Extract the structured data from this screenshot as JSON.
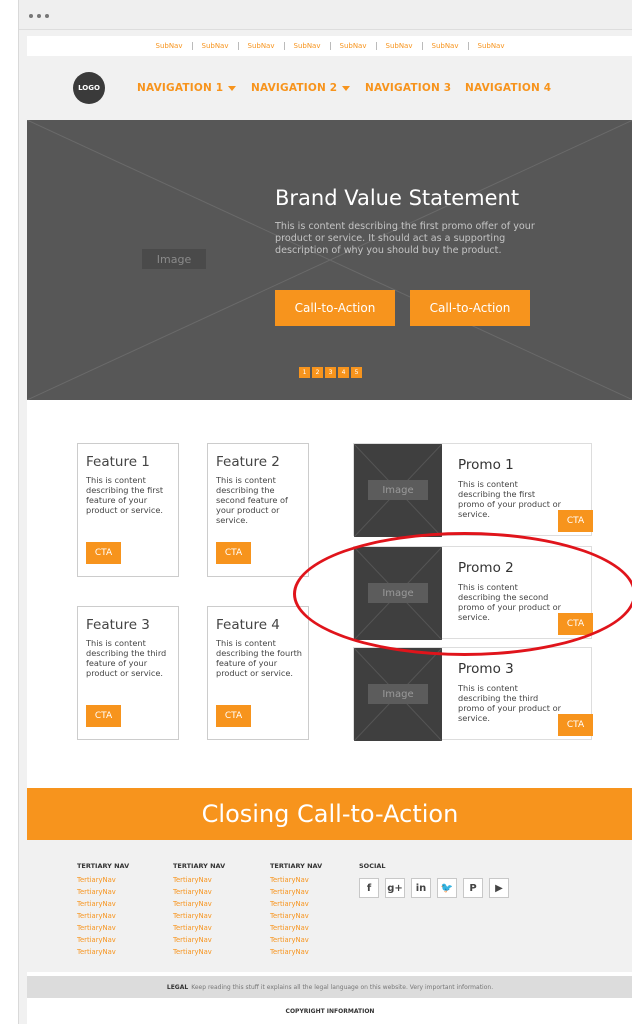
{
  "subnav": [
    "SubNav",
    "SubNav",
    "SubNav",
    "SubNav",
    "SubNav",
    "SubNav",
    "SubNav",
    "SubNav"
  ],
  "header": {
    "logo": "LOGO",
    "nav": [
      "NAVIGATION 1",
      "NAVIGATION 2",
      "NAVIGATION 3",
      "NAVIGATION 4"
    ]
  },
  "hero": {
    "image_label": "Image",
    "title": "Brand Value Statement",
    "description": "This is content describing the first promo offer of your product or service. It should act as a supporting description of why you should buy the product.",
    "cta1": "Call-to-Action",
    "cta2": "Call-to-Action",
    "pages": [
      "1",
      "2",
      "3",
      "4",
      "5"
    ]
  },
  "features": [
    {
      "title": "Feature 1",
      "desc": "This is content describing the first feature of your product or service.",
      "cta": "CTA"
    },
    {
      "title": "Feature 2",
      "desc": "This is content describing the second feature of your product or service.",
      "cta": "CTA"
    },
    {
      "title": "Feature 3",
      "desc": "This is content describing the third feature of your product or service.",
      "cta": "CTA"
    },
    {
      "title": "Feature 4",
      "desc": "This is content describing the fourth feature of your product or service.",
      "cta": "CTA"
    }
  ],
  "promos": [
    {
      "title": "Promo 1",
      "desc": "This is content describing the first promo of your product or service.",
      "cta": "CTA",
      "image_label": "Image"
    },
    {
      "title": "Promo 2",
      "desc": "This is content describing the second promo of your product or service.",
      "cta": "CTA",
      "image_label": "Image"
    },
    {
      "title": "Promo 3",
      "desc": "This is content describing the third promo of your product or service.",
      "cta": "CTA",
      "image_label": "Image"
    }
  ],
  "closing": "Closing Call-to-Action",
  "footer": {
    "columns": [
      {
        "heading": "TERTIARY NAV",
        "links": [
          "TertiaryNav",
          "TertiaryNav",
          "TertiaryNav",
          "TertiaryNav",
          "TertiaryNav",
          "TertiaryNav",
          "TertiaryNav"
        ]
      },
      {
        "heading": "TERTIARY NAV",
        "links": [
          "TertiaryNav",
          "TertiaryNav",
          "TertiaryNav",
          "TertiaryNav",
          "TertiaryNav",
          "TertiaryNav",
          "TertiaryNav"
        ]
      },
      {
        "heading": "TERTIARY NAV",
        "links": [
          "TertiaryNav",
          "TertiaryNav",
          "TertiaryNav",
          "TertiaryNav",
          "TertiaryNav",
          "TertiaryNav",
          "TertiaryNav"
        ]
      }
    ],
    "social_heading": "SOCIAL",
    "social": [
      {
        "name": "facebook-icon",
        "glyph": "f"
      },
      {
        "name": "google-plus-icon",
        "glyph": "g+"
      },
      {
        "name": "linkedin-icon",
        "glyph": "in"
      },
      {
        "name": "twitter-icon",
        "glyph": "🐦"
      },
      {
        "name": "pinterest-icon",
        "glyph": "P"
      },
      {
        "name": "youtube-icon",
        "glyph": "▶"
      }
    ]
  },
  "legal": {
    "label": "LEGAL",
    "text": "Keep reading this stuff it explains all the legal language on this website. Very important information."
  },
  "copyright": "COPYRIGHT INFORMATION",
  "colors": {
    "accent": "#f7941d",
    "hero_bg": "#575757",
    "annotation": "#e0141b"
  }
}
